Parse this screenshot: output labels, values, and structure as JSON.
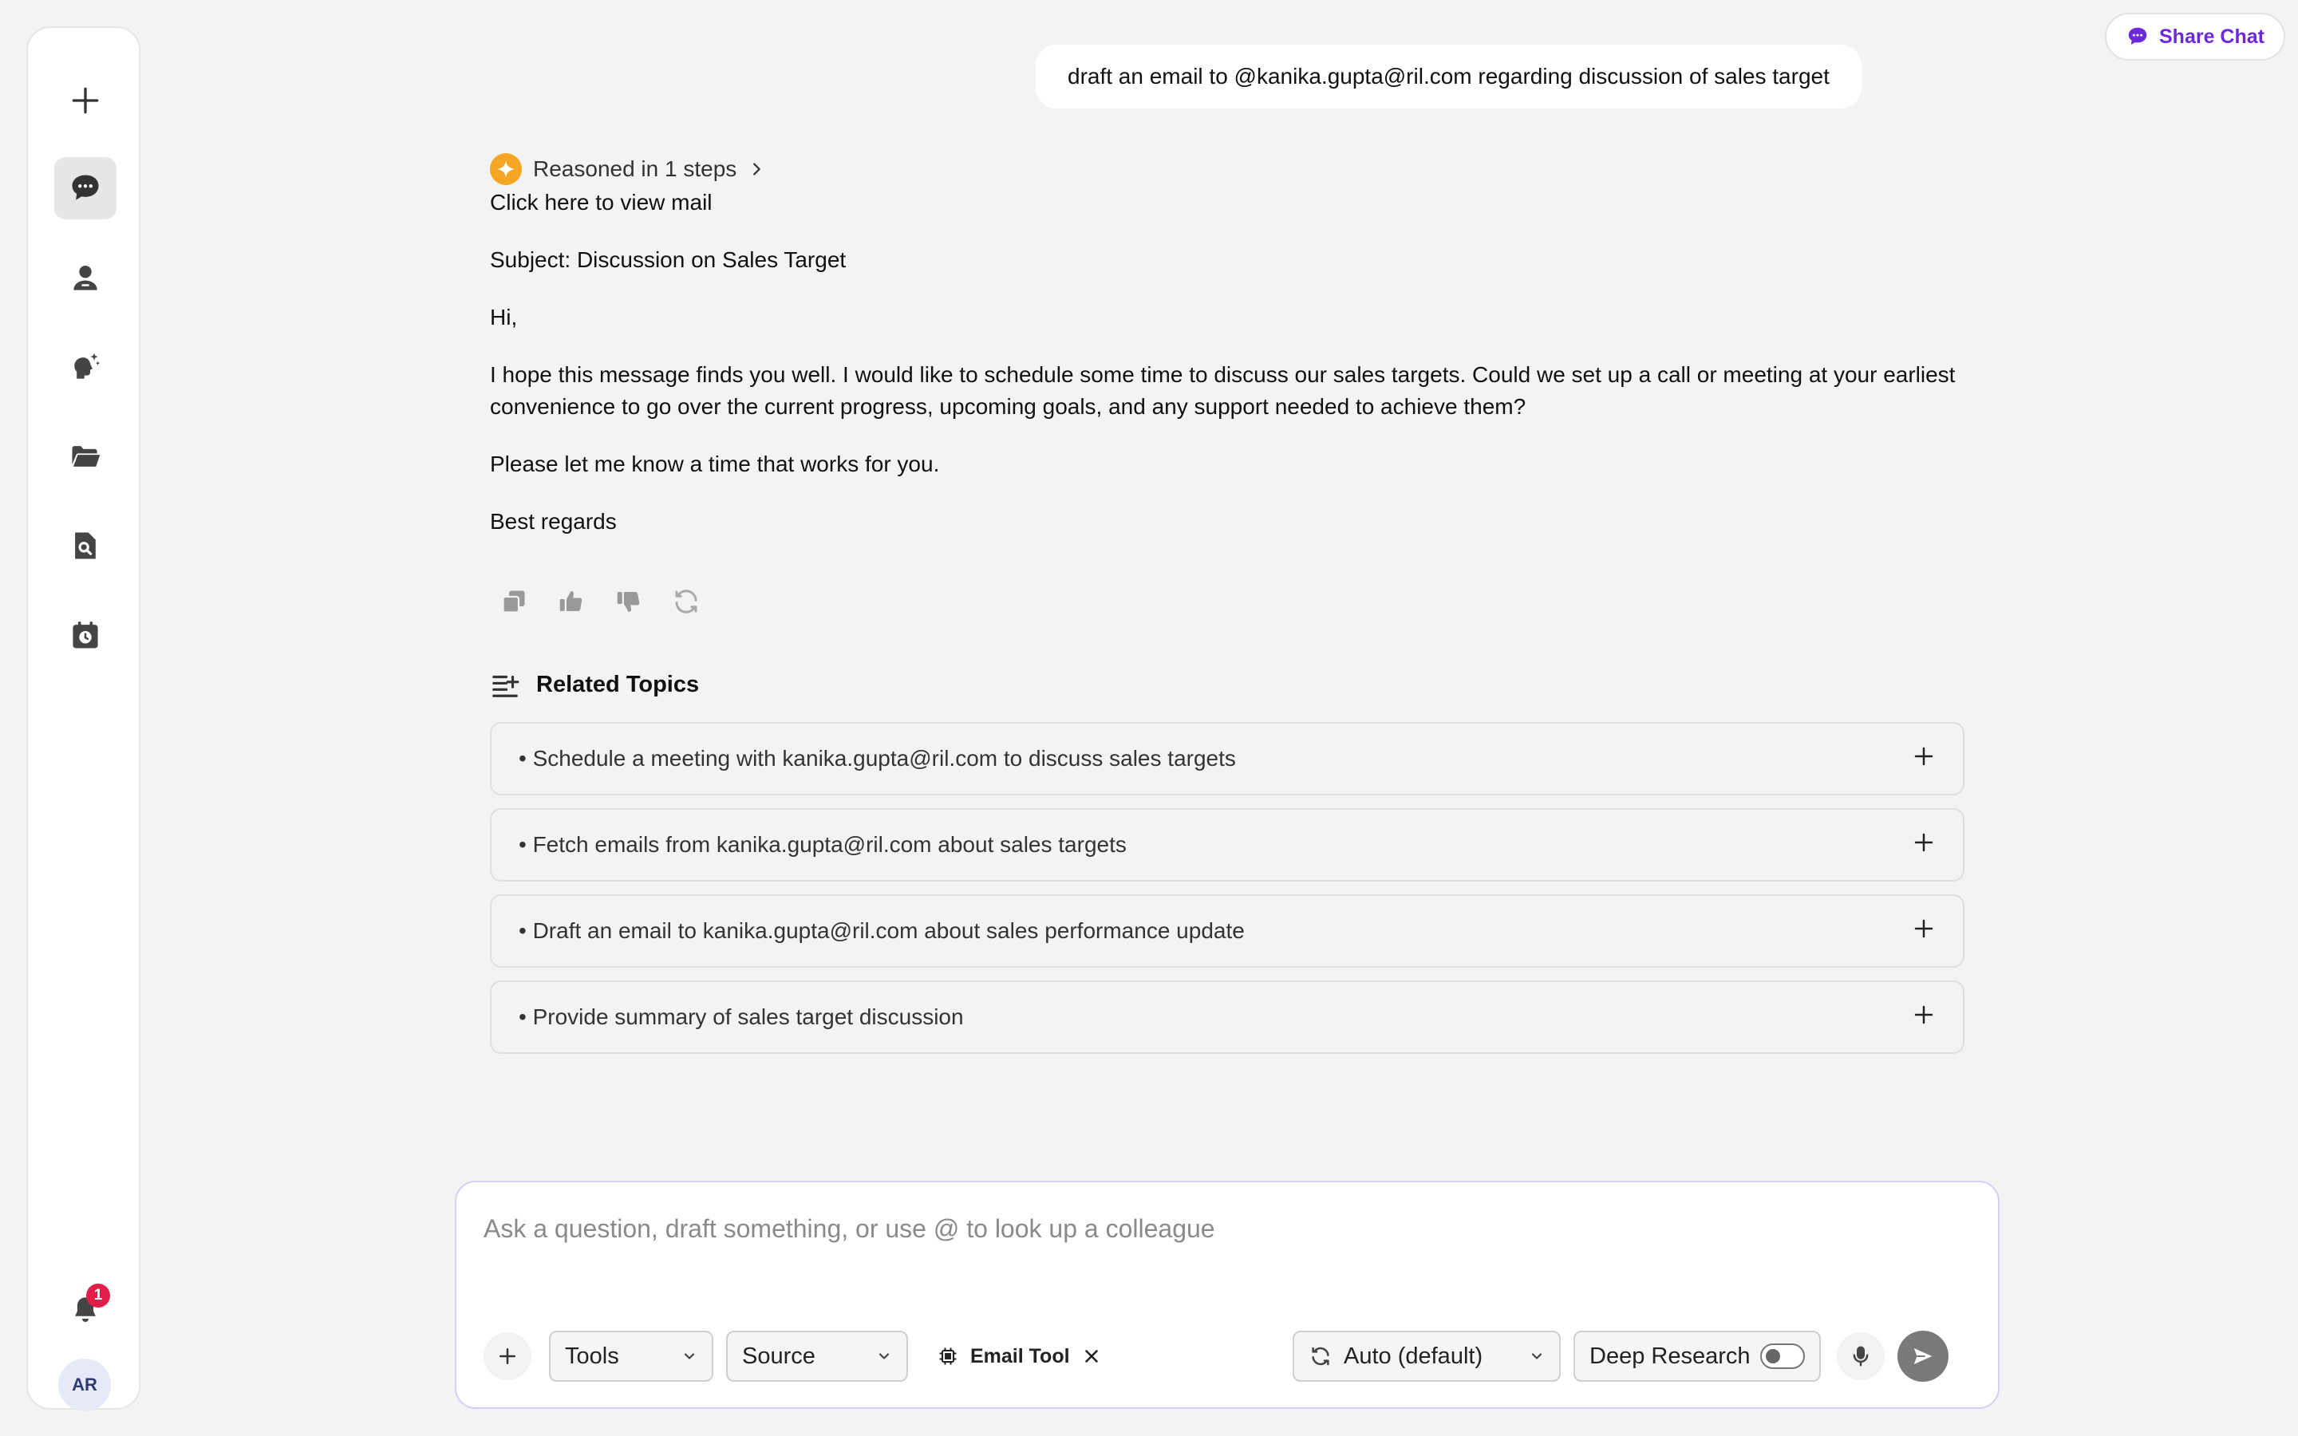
{
  "header": {
    "share_label": "Share Chat"
  },
  "sidebar": {
    "items": [
      {
        "icon": "plus-icon"
      },
      {
        "icon": "chat-icon",
        "active": true
      },
      {
        "icon": "user-icon"
      },
      {
        "icon": "brain-sparkle-icon"
      },
      {
        "icon": "folder-icon"
      },
      {
        "icon": "file-search-icon"
      },
      {
        "icon": "calendar-clock-icon"
      }
    ],
    "notification_count": "1",
    "avatar_initials": "AR"
  },
  "chat": {
    "user_message": "draft an email to @kanika.gupta@ril.com regarding discussion of sales target",
    "reasoning_label": "Reasoned in 1 steps",
    "response": {
      "view_mail": "Click here to view mail",
      "subject": "Subject: Discussion on Sales Target",
      "greeting": "Hi,",
      "body": "I hope this message finds you well. I would like to schedule some time to discuss our sales targets. Could we set up a call or meeting at your earliest convenience to go over the current progress, upcoming goals, and any support needed to achieve them?",
      "closing_request": "Please let me know a time that works for you.",
      "signoff": "Best regards"
    },
    "related_title": "Related Topics",
    "related_topics": [
      "• Schedule a meeting with kanika.gupta@ril.com to discuss sales targets",
      "• Fetch emails from kanika.gupta@ril.com about sales targets",
      "• Draft an email to kanika.gupta@ril.com about sales performance update",
      "• Provide summary of sales target discussion"
    ]
  },
  "composer": {
    "placeholder": "Ask a question, draft something, or use @ to look up a colleague",
    "value": "",
    "tools_label": "Tools",
    "source_label": "Source",
    "email_tool_label": "Email Tool",
    "model_label": "Auto (default)",
    "deep_research_label": "Deep Research",
    "deep_research_enabled": false
  },
  "colors": {
    "accent": "#6d28d9",
    "badge": "#e11d48",
    "reason_icon": "#f5a623"
  }
}
